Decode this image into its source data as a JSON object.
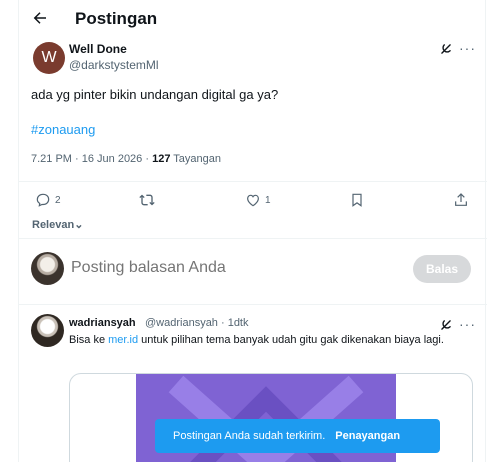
{
  "header": {
    "title": "Postingan",
    "back_icon": "arrow-left-icon"
  },
  "post": {
    "avatar_letter": "W",
    "author_name": "Well Done",
    "author_handle": "@darkstystemMl",
    "text": "ada yg pinter bikin undangan digital ga ya?",
    "hashtag": "#zonauang",
    "time_date": "7.21 PM · 16 Jun 2026 · ",
    "views_count": "127",
    "views_label": "Tayangan",
    "actions": {
      "reply_count": "2",
      "retweet_count": "",
      "like_count": "1"
    }
  },
  "sort_label": "Relevan",
  "reply_box": {
    "placeholder": "Posting balasan Anda",
    "button_label": "Balas"
  },
  "replies": [
    {
      "name": "wadriansyah",
      "handle": "@wadriansyah · 1dtk",
      "text_before": "Bisa ke ",
      "link": "mer.id",
      "text_after": " untuk pilihan tema banyak udah gitu gak dikenakan biaya lagi."
    }
  ],
  "toast": {
    "message": "Postingan Anda sudah terkirim.",
    "action": "Penayangan"
  },
  "colors": {
    "accent": "#1d9bf0",
    "muted": "#536471",
    "text": "#0f1419"
  }
}
